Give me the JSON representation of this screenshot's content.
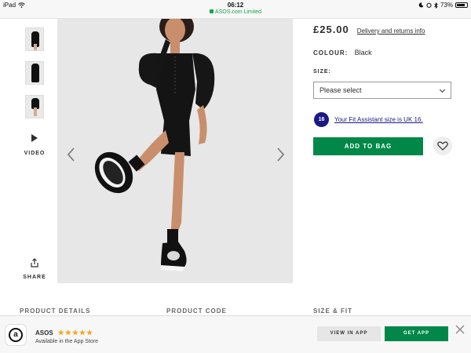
{
  "status_bar": {
    "device": "iPad",
    "time": "06:12",
    "url": "ASOS.com Limited",
    "battery": "73%"
  },
  "gallery": {
    "thumbnails": [
      {
        "alt": "thumbnail-1"
      },
      {
        "alt": "thumbnail-2"
      },
      {
        "alt": "thumbnail-3"
      }
    ],
    "video_label": "VIDEO",
    "share_label": "SHARE"
  },
  "product": {
    "price": "£25.00",
    "delivery_link": "Delivery and returns info",
    "colour_label": "COLOUR:",
    "colour_value": "Black",
    "size_label": "SIZE:",
    "size_placeholder": "Please select",
    "fit_badge": "16",
    "fit_text": "Your Fit Assistant size is UK 16.",
    "add_to_bag": "ADD TO BAG"
  },
  "sections": {
    "details": "PRODUCT DETAILS",
    "code": "PRODUCT CODE",
    "size_fit": "SIZE & FIT"
  },
  "app_banner": {
    "name": "ASOS",
    "stars": "★★★★★",
    "subtitle": "Available in the App Store",
    "view_in_app": "VIEW IN APP",
    "get_app": "GET APP"
  },
  "colors": {
    "accent_green": "#018849",
    "fit_blue": "#1b1a83",
    "star_gold": "#f5a623"
  }
}
